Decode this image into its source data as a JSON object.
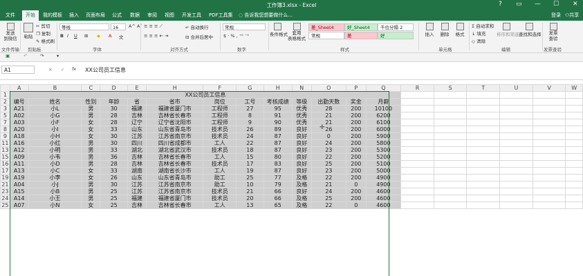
{
  "window": {
    "title": "工作簿3.xlsx - Excel",
    "controls": {
      "help": "?",
      "restore": "▭",
      "minimize": "—",
      "maximize": "☐",
      "close": "✕"
    }
  },
  "tabs": [
    "文件",
    "开始",
    "我的模板",
    "插入",
    "页面布局",
    "公式",
    "数据",
    "审阅",
    "视图",
    "开发工具",
    "PDF工具集"
  ],
  "active_tab": "开始",
  "tell_me": "告诉我您想要做什么...",
  "account": {
    "login": "登录",
    "share": "共享"
  },
  "ribbon": {
    "send": "发送\n到微信",
    "paste": "粘贴",
    "cut": "剪切",
    "copy": "复制",
    "format_painter": "格式刷",
    "font_name": "等线",
    "font_size": "16",
    "bold": "B",
    "italic": "I",
    "underline": "U",
    "wrap": "自动换行",
    "merge": "合并后居中",
    "number_format": "常规",
    "conditional": "条件格式",
    "table_fmt": "套用\n表格格式",
    "styles": {
      "sheet4": "差_Sheet4",
      "sheet4_good": "好_Sheet4",
      "thousands": "千位分隔 2",
      "normal": "常规",
      "bad": "差",
      "good": "好"
    },
    "insert": "插入",
    "delete": "删除",
    "format": "格式",
    "autosum": "自动求和",
    "fill": "填充",
    "clear": "清除",
    "sort": "排序和筛选",
    "find": "查找和选择",
    "invoice": "发票\n查验",
    "groups": {
      "file_transfer": "文件传输",
      "clipboard": "剪贴板",
      "font": "字体",
      "alignment": "对齐方式",
      "number": "数字",
      "style": "样式",
      "cells": "单元格",
      "editing": "编辑",
      "invoice_check": "发票查验"
    }
  },
  "formula_bar": {
    "name_box": "A1",
    "content": "XX公司员工信息"
  },
  "columns": [
    "A",
    "B",
    "C",
    "D",
    "E",
    "H",
    "F",
    "G",
    "H",
    "N",
    "O",
    "P",
    "Q",
    "R",
    "S",
    "T",
    "U",
    "V",
    "W"
  ],
  "sheet": {
    "title": "XX公司员工信息",
    "headers": [
      "编号",
      "姓名",
      "性别",
      "年龄",
      "省",
      "省市",
      "岗位",
      "工号",
      "考核成绩",
      "等级",
      "出勤天数",
      "奖金",
      "月薪"
    ],
    "rows": [
      {
        "rn": "3",
        "tall": false,
        "cells": [
          "A21",
          "小L",
          "男",
          "30",
          "福建",
          "福建省厦门市",
          "工程师",
          "27",
          "95",
          "优秀",
          "28",
          "200",
          "10100"
        ]
      },
      {
        "rn": "5",
        "tall": true,
        "cells": [
          "A02",
          "小G",
          "男",
          "28",
          "吉林",
          "吉林省长春市",
          "工程师",
          "8",
          "91",
          "优秀",
          "21",
          "200",
          "6200"
        ]
      },
      {
        "rn": "7",
        "tall": false,
        "cells": [
          "A03",
          "小F",
          "女",
          "28",
          "辽宁",
          "辽宁省沈阳市",
          "工程师",
          "9",
          "90",
          "优秀",
          "21",
          "200",
          "6100"
        ]
      },
      {
        "rn": "8",
        "tall": false,
        "cells": [
          "A20",
          "小I",
          "女",
          "33",
          "山东",
          "山东省青岛市",
          "技术员",
          "26",
          "89",
          "良好",
          "26",
          "200",
          "6000"
        ]
      },
      {
        "rn": "9",
        "tall": false,
        "cells": [
          "A18",
          "小H",
          "女",
          "30",
          "江苏",
          "江苏省南京市",
          "技术员",
          "24",
          "87",
          "良好",
          "0",
          "200",
          "5900"
        ]
      },
      {
        "rn": "11",
        "tall": true,
        "cells": [
          "A16",
          "小红",
          "男",
          "30",
          "四川",
          "四川省成都市",
          "工人",
          "22",
          "87",
          "良好",
          "24",
          "200",
          "5800"
        ]
      },
      {
        "rn": "13",
        "tall": true,
        "cells": [
          "A12",
          "小明",
          "男",
          "33",
          "湖北",
          "湖北省武汉市",
          "技术员",
          "18",
          "87",
          "良好",
          "23",
          "200",
          "5300"
        ]
      },
      {
        "rn": "15",
        "tall": false,
        "cells": [
          "A09",
          "小韦",
          "男",
          "36",
          "吉林",
          "吉林省长春市",
          "工人",
          "15",
          "80",
          "良好",
          "22",
          "200",
          "5200"
        ]
      },
      {
        "rn": "16",
        "tall": false,
        "cells": [
          "A11",
          "小D",
          "男",
          "28",
          "吉林",
          "吉林省长春市",
          "技术员",
          "17",
          "83",
          "良好",
          "25",
          "200",
          "5100"
        ]
      },
      {
        "rn": "17",
        "tall": false,
        "cells": [
          "A13",
          "小C",
          "女",
          "33",
          "湖南",
          "湖南省长沙市",
          "工人",
          "19",
          "87",
          "良好",
          "23",
          "200",
          "5000"
        ]
      },
      {
        "rn": "19",
        "tall": true,
        "cells": [
          "A19",
          "小李",
          "女",
          "26",
          "山东",
          "山东省青岛市",
          "助工",
          "25",
          "77",
          "及格",
          "22",
          "200",
          "4900"
        ]
      },
      {
        "rn": "21",
        "tall": true,
        "cells": [
          "A04",
          "小J",
          "男",
          "30",
          "江苏",
          "江苏省南京市",
          "助工",
          "10",
          "79",
          "及格",
          "21",
          "0",
          "4900"
        ]
      },
      {
        "rn": "23",
        "tall": false,
        "cells": [
          "A15",
          "小B",
          "男",
          "25",
          "江苏",
          "江苏省南京市",
          "技术员",
          "21",
          "66",
          "良好",
          "24",
          "200",
          "4600"
        ]
      },
      {
        "rn": "24",
        "tall": false,
        "cells": [
          "A14",
          "小王",
          "男",
          "25",
          "福建",
          "福建省厦门市",
          "技术员",
          "20",
          "66",
          "及格",
          "25",
          "200",
          "4600"
        ]
      },
      {
        "rn": "25",
        "tall": false,
        "cells": [
          "A07",
          "小N",
          "女",
          "25",
          "吉林",
          "吉林省长春市",
          "工人",
          "13",
          "65",
          "及格",
          "22",
          "0",
          "4600"
        ]
      }
    ]
  }
}
